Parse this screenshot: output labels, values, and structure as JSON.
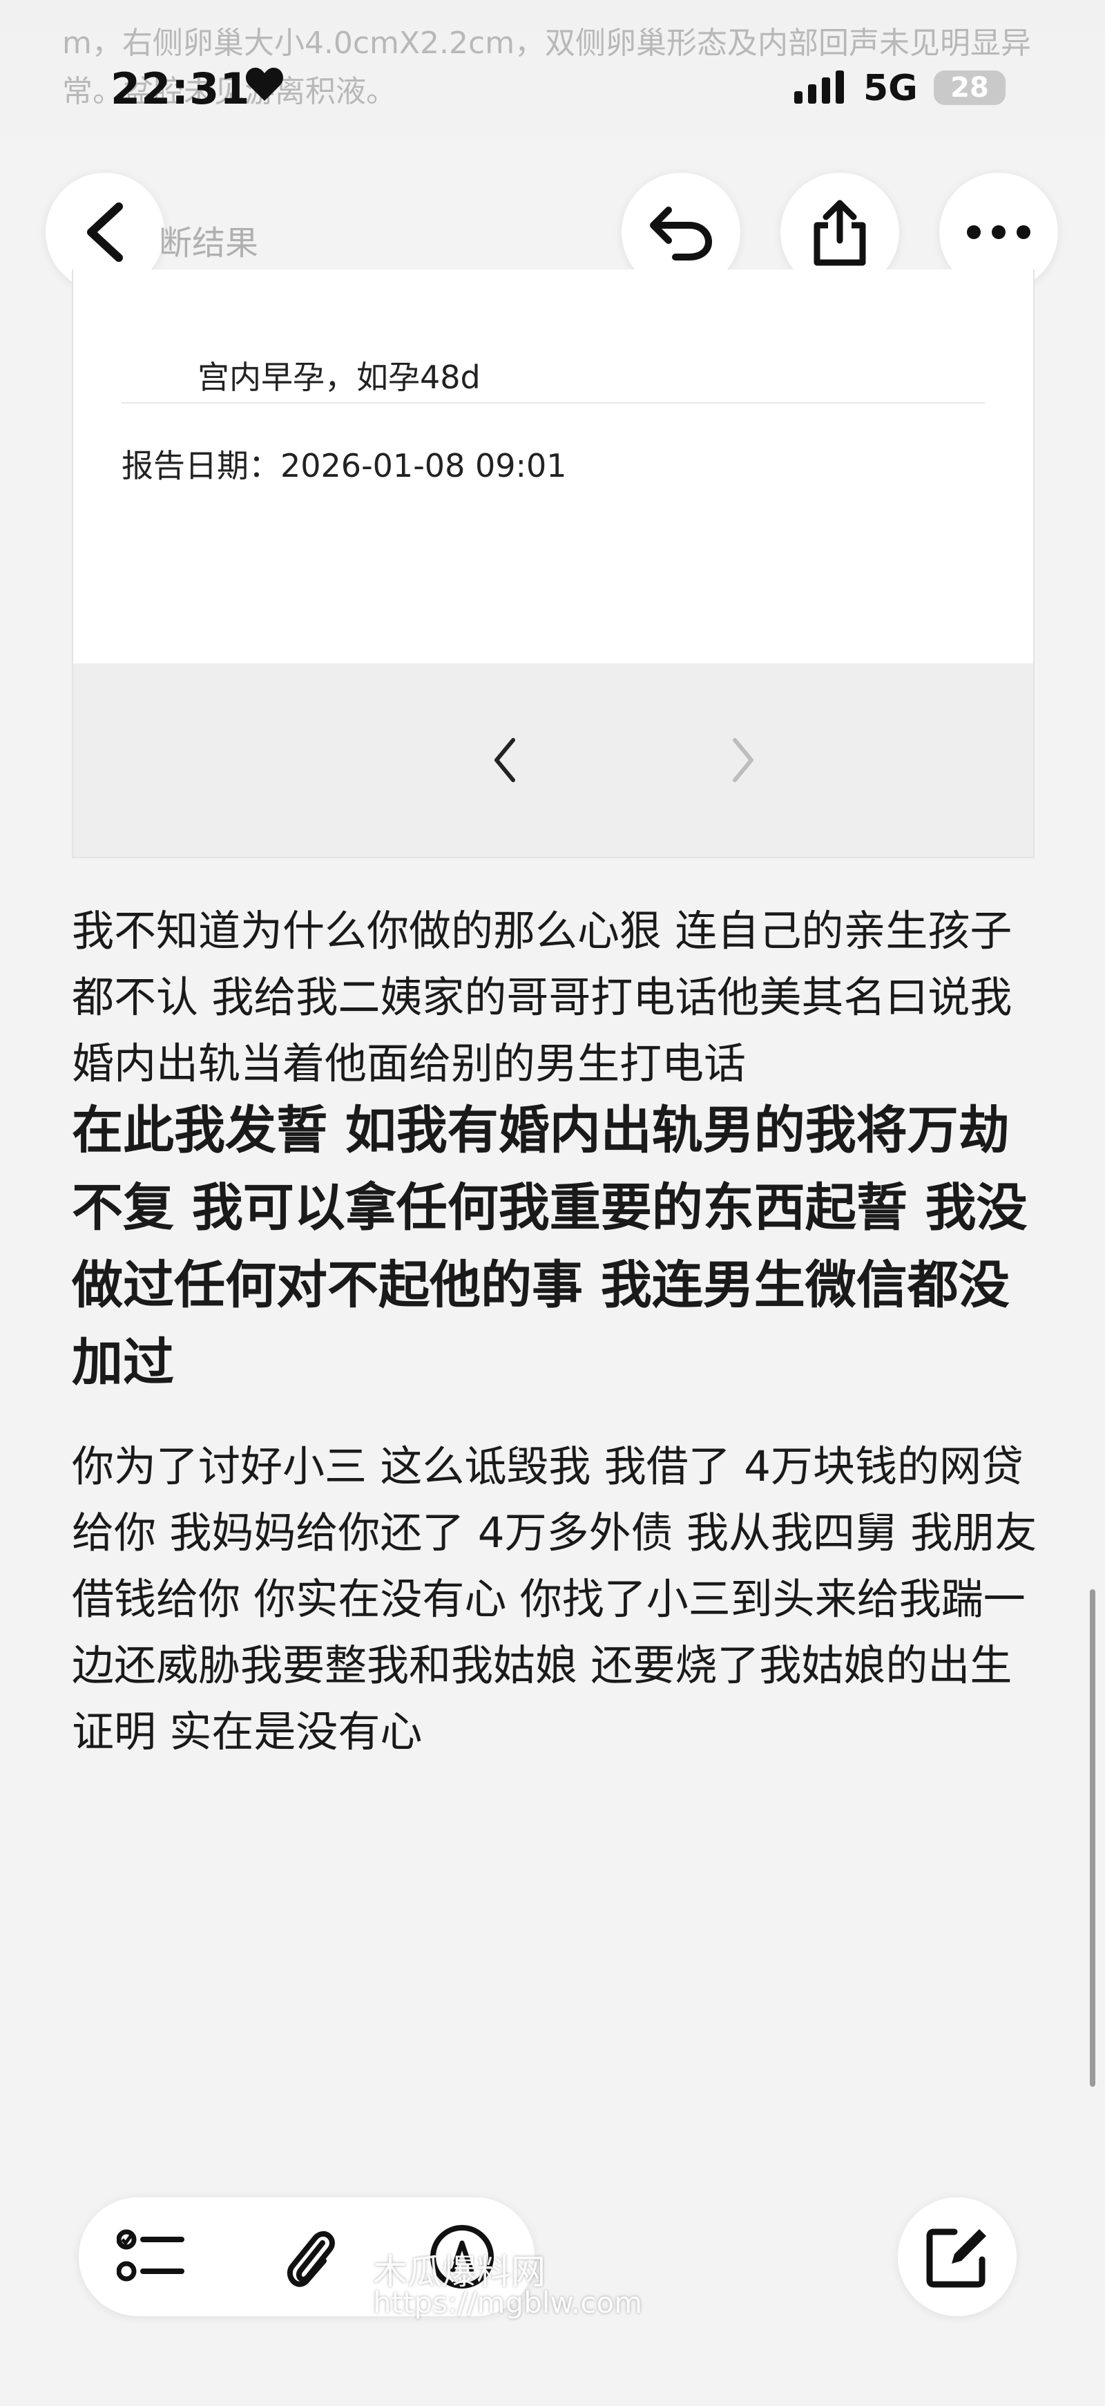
{
  "status_bar": {
    "time": "22:31",
    "network": "5G",
    "battery": "28",
    "overlap_text": "m，右侧卵巢大小4.0cmX2.2cm，双侧卵巢形态及内部回声未见明显异常。盆腔未见游离积液。"
  },
  "nav": {
    "title": "断结果"
  },
  "report": {
    "diagnosis": "宫内早孕，如孕48d",
    "date_label": "报告日期：",
    "date_value": "2026-01-08 09:01"
  },
  "note": {
    "para1": "我不知道为什么你做的那么心狠 连自己的亲生孩子都不认 我给我二姨家的哥哥打电话他美其名曰说我婚内出轨当着他面给别的男生打电话",
    "para2": "在此我发誓 如我有婚内出轨男的我将万劫不复 我可以拿任何我重要的东西起誓 我没做过任何对不起他的事 我连男生微信都没加过",
    "para3": "你为了讨好小三 这么诋毁我 我借了 4万块钱的网贷给你 我妈妈给你还了 4万多外债 我从我四舅 我朋友借钱给你 你实在没有心 你找了小三到头来给我踹一边还威胁我要整我和我姑娘 还要烧了我姑娘的出生证明 实在是没有心"
  },
  "watermark": {
    "title": "木瓜爆料网",
    "url": "https://mgblw.com"
  },
  "icons": {
    "back": "chevron-left-icon",
    "undo": "undo-icon",
    "share": "share-icon",
    "more": "more-icon",
    "checklist": "checklist-icon",
    "attach": "paperclip-icon",
    "markup": "markup-pen-icon",
    "compose": "compose-icon"
  }
}
